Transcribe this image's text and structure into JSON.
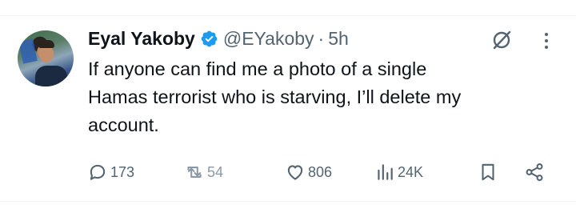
{
  "tweet": {
    "author_name": "Eyal Yakoby",
    "handle": "@EYakoby",
    "separator": "·",
    "time": "5h",
    "text": "If anyone can find me a photo of a single\nHamas terrorist who is starving, I’ll delete my\naccount."
  },
  "actions": {
    "replies": "173",
    "reposts": "54",
    "likes": "806",
    "views": "24K"
  },
  "colors": {
    "verified_blue": "#1d9bf0",
    "muted_gray": "#536471",
    "text": "#0f1419"
  },
  "icons": [
    "verified-badge-icon",
    "grok-icon",
    "more-icon",
    "reply-icon",
    "repost-icon",
    "like-icon",
    "views-icon",
    "bookmark-icon",
    "share-icon"
  ]
}
